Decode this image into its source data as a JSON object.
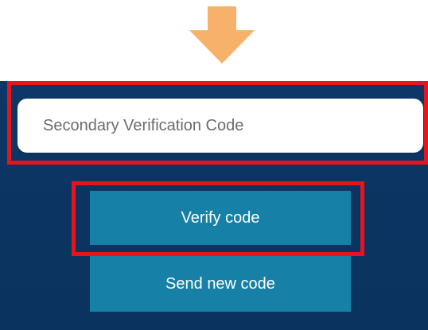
{
  "icons": {
    "arrow": "arrow-down-icon",
    "arrow_color": "#f6b26b"
  },
  "verification": {
    "input_placeholder": "Secondary Verification Code",
    "input_value": ""
  },
  "actions": {
    "verify_label": "Verify code",
    "send_new_label": "Send new code"
  },
  "colors": {
    "panel_bg": "#0c3462",
    "button_bg": "#1680a6",
    "highlight": "#e8131b"
  }
}
